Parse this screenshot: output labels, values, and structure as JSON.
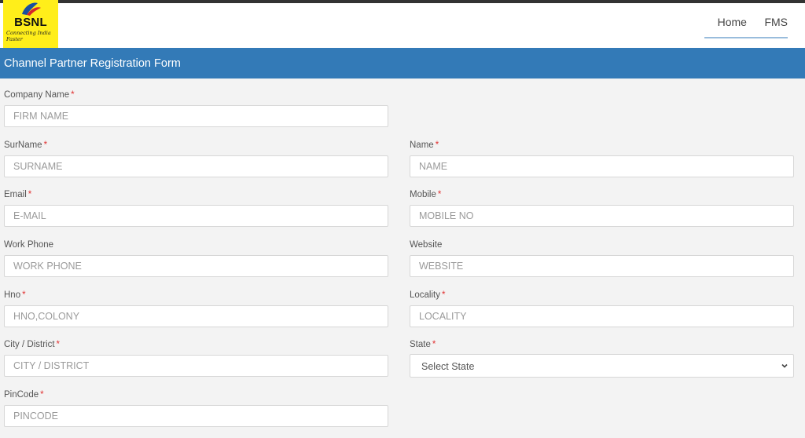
{
  "nav": {
    "logo_text": "BSNL",
    "logo_tagline": "Connecting India Faster",
    "links": [
      "Home",
      "FMS"
    ]
  },
  "form": {
    "title": "Channel Partner Registration Form",
    "fields": {
      "company_name": {
        "label": "Company Name",
        "placeholder": "FIRM NAME"
      },
      "surname": {
        "label": "SurName",
        "placeholder": "SURNAME"
      },
      "name": {
        "label": "Name",
        "placeholder": "NAME"
      },
      "email": {
        "label": "Email",
        "placeholder": "E-MAIL"
      },
      "mobile": {
        "label": "Mobile",
        "placeholder": "MOBILE NO"
      },
      "work_phone": {
        "label": "Work Phone",
        "placeholder": "WORK PHONE"
      },
      "website": {
        "label": "Website",
        "placeholder": "WEBSITE"
      },
      "hno": {
        "label": "Hno",
        "placeholder": "HNO,COLONY"
      },
      "locality": {
        "label": "Locality",
        "placeholder": "LOCALITY"
      },
      "city": {
        "label": "City / District",
        "placeholder": "CITY / DISTRICT"
      },
      "state": {
        "label": "State",
        "selected": "Select State"
      },
      "pincode": {
        "label": "PinCode",
        "placeholder": "PINCODE"
      }
    },
    "required_marker": "*"
  },
  "colors": {
    "header_blue": "#337ab7",
    "logo_yellow": "#ffee1a",
    "required_red": "#e13333"
  }
}
